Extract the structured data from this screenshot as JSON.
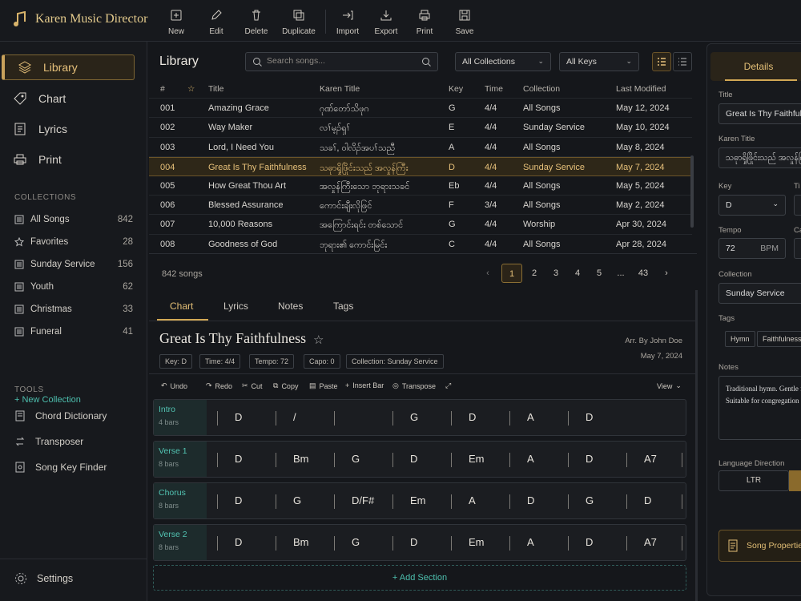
{
  "app": {
    "title": "Karen Music Director"
  },
  "toolbar": {
    "new": "New",
    "edit": "Edit",
    "delete": "Delete",
    "duplicate": "Duplicate",
    "import": "Import",
    "export": "Export",
    "print": "Print",
    "save": "Save"
  },
  "sidebar": {
    "nav": [
      {
        "label": "Library",
        "icon": "layers-icon"
      },
      {
        "label": "Chart",
        "icon": "tag-icon"
      },
      {
        "label": "Lyrics",
        "icon": "document-icon"
      },
      {
        "label": "Print",
        "icon": "printer-icon"
      }
    ],
    "collections_title": "COLLECTIONS",
    "collections": [
      {
        "label": "All Songs",
        "count": "842"
      },
      {
        "label": "Favorites",
        "count": "28"
      },
      {
        "label": "Sunday Service",
        "count": "156"
      },
      {
        "label": "Youth",
        "count": "62"
      },
      {
        "label": "Christmas",
        "count": "33"
      },
      {
        "label": "Funeral",
        "count": "41"
      }
    ],
    "new_collection": "+ New Collection",
    "tools_title": "TOOLS",
    "tools": [
      "Chord Dictionary",
      "Transposer",
      "Song Key Finder"
    ],
    "settings": "Settings"
  },
  "library": {
    "title": "Library",
    "search_placeholder": "Search songs...",
    "collection_filter": "All Collections",
    "key_filter": "All Keys",
    "columns": [
      "#",
      "Title",
      "Karen Title",
      "Key",
      "Time",
      "Collection",
      "Last Modified"
    ],
    "rows": [
      [
        "001",
        "Amazing Grace",
        "ဂုဏ်တော်သိဖုဂ",
        "G",
        "4/4",
        "All Songs",
        "May 12, 2024"
      ],
      [
        "002",
        "Way Maker",
        "လၢ်မ့ၣ်ရှၢ်",
        "E",
        "4/4",
        "Sunday Service",
        "May 10, 2024"
      ],
      [
        "003",
        "Lord, I Need You",
        "သခၢ်, ဝါလိၣ်အပၢ်သညီ",
        "A",
        "4/4",
        "All Songs",
        "May 8, 2024"
      ],
      [
        "004",
        "Great Is Thy Faithfulness",
        "သဓုာရှိုဖြိုင်းသည် အလှုန်ကြီး",
        "D",
        "4/4",
        "Sunday Service",
        "May 7, 2024"
      ],
      [
        "005",
        "How Great Thou Art",
        "အလှုန်ကြီးသော ဘုရားသခင်",
        "Eb",
        "4/4",
        "All Songs",
        "May 5, 2024"
      ],
      [
        "006",
        "Blessed Assurance",
        "ကောင်းချီးလိုဖြင်",
        "F",
        "3/4",
        "All Songs",
        "May 2, 2024"
      ],
      [
        "007",
        "10,000 Reasons",
        "အကြောင်းရင်း တစ်သောင်",
        "G",
        "4/4",
        "Worship",
        "Apr 30, 2024"
      ],
      [
        "008",
        "Goodness of God",
        "ဘုရား၏ ကောင်းမြင်း",
        "C",
        "4/4",
        "All Songs",
        "Apr 28, 2024"
      ]
    ],
    "song_count": "842 songs",
    "pages": [
      "1",
      "2",
      "3",
      "4",
      "5",
      "...",
      "43"
    ]
  },
  "editor": {
    "tabs": [
      "Chart",
      "Lyrics",
      "Notes",
      "Tags"
    ],
    "song_title": "Great Is Thy Faithfulness",
    "arranger": "Arr. By  John Doe",
    "date": "May 7, 2024",
    "meta": [
      "Key: D",
      "Time: 4/4",
      "Tempo: 72",
      "Capo: 0",
      "Collection: Sunday Service"
    ],
    "tools": [
      "Undo",
      "Redo",
      "Cut",
      "Copy",
      "Paste",
      "Insert Bar",
      "Transpose"
    ],
    "view": "View",
    "sections": [
      {
        "name": "Intro",
        "bars": "4 bars",
        "chords": [
          "D",
          "/",
          "",
          "G",
          "D",
          "A",
          "D"
        ]
      },
      {
        "name": "Verse 1",
        "bars": "8 bars",
        "chords": [
          "D",
          "Bm",
          "G",
          "D",
          "Em",
          "A",
          "D",
          "A7"
        ]
      },
      {
        "name": "Chorus",
        "bars": "8 bars",
        "chords": [
          "D",
          "G",
          "D/F#",
          "Em",
          "A",
          "D",
          "G",
          "D"
        ]
      },
      {
        "name": "Verse 2",
        "bars": "8 bars",
        "chords": [
          "D",
          "Bm",
          "G",
          "D",
          "Em",
          "A",
          "D",
          "A7"
        ]
      }
    ],
    "add_section": "+ Add Section"
  },
  "panel": {
    "tab": "Details",
    "title_label": "Title",
    "title": "Great Is Thy Faithfulness",
    "karen_label": "Karen Title",
    "karen": "သဓုာရှိုဖြိုင်းသည် အလှုန်ကြီး",
    "key_label": "Key",
    "key": "D",
    "time_label": "Ti",
    "tempo_label": "Tempo",
    "tempo": "72",
    "bpm": "BPM",
    "capo_label": "Ca",
    "collection_label": "Collection",
    "collection": "Sunday Service",
    "tags_label": "Tags",
    "tags": [
      "Hymn",
      "Faithfulness"
    ],
    "notes_label": "Notes",
    "notes": "Traditional hymn. Gentle feel. Suitable for congregation",
    "lang_label": "Language Direction",
    "ltr": "LTR",
    "props": "Song Properties"
  },
  "colors": {
    "accent": "#d2a855",
    "teal": "#4dbfae",
    "bg": "#15171b"
  }
}
